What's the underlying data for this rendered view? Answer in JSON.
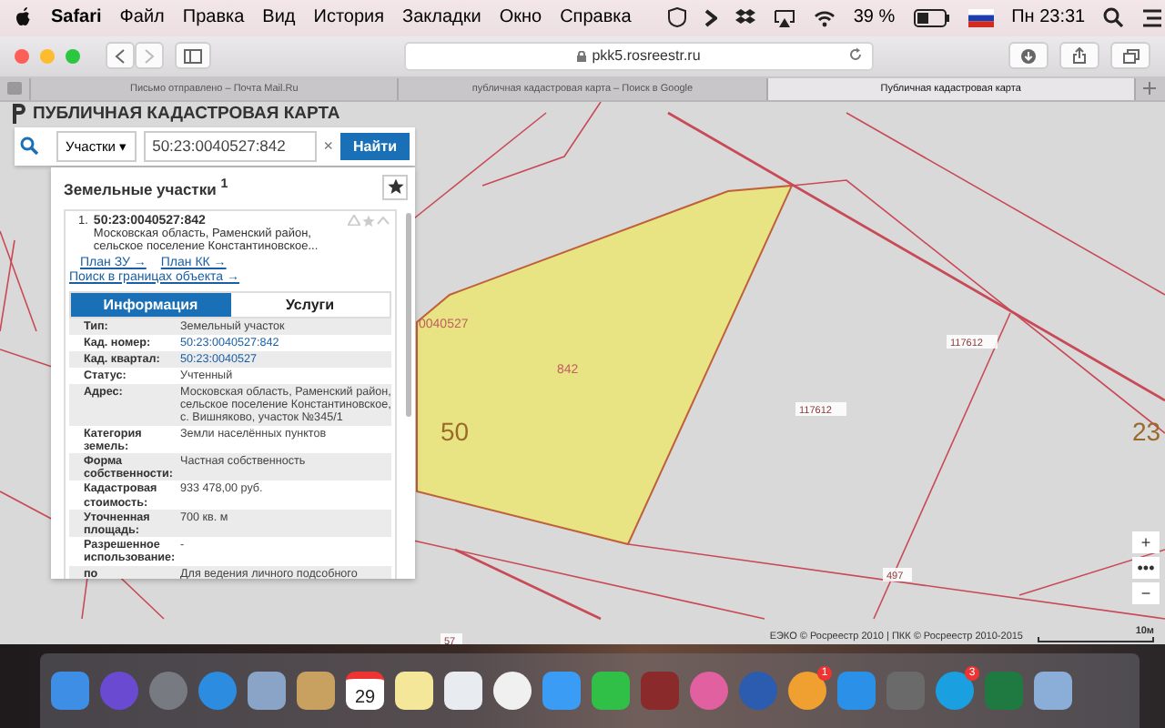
{
  "menu_bar": {
    "app": "Safari",
    "items": [
      "Файл",
      "Правка",
      "Вид",
      "История",
      "Закладки",
      "Окно",
      "Справка"
    ],
    "battery": "39 %",
    "clock": "Пн 23:31"
  },
  "toolbar": {
    "url": "pkk5.rosreestr.ru"
  },
  "tabs": [
    {
      "label": "Письмо отправлено – Почта Mail.Ru",
      "selected": false
    },
    {
      "label": "публичная кадастровая карта – Поиск в Google",
      "selected": false
    },
    {
      "label": "Публичная кадастровая карта",
      "selected": true
    }
  ],
  "page": {
    "title": "ПУБЛИЧНАЯ КАДАСТРОВАЯ КАРТА",
    "search": {
      "category": "Участки ▾",
      "value": "50:23:0040527:842",
      "clear": "×",
      "button": "Найти"
    },
    "results": {
      "title": "Земельные участки $^{1}$",
      "item": {
        "index": "1.",
        "number": "50:23:0040527:842",
        "address": "Московская область, Раменский район, сельское поселение Константиновское...",
        "links": [
          "План ЗУ →",
          "План КК →",
          "Поиск в границах объекта →"
        ],
        "tabs": [
          {
            "label": "Информация",
            "selected": true
          },
          {
            "label": "Услуги",
            "selected": false
          }
        ],
        "rows": [
          {
            "label": "Тип:",
            "value": "Земельный участок",
            "kind": "text"
          },
          {
            "label": "Кад. номер:",
            "value": "50:23:0040527:842",
            "kind": "link"
          },
          {
            "label": "Кад. квартал:",
            "value": "50:23:0040527",
            "kind": "link"
          },
          {
            "label": "Статус:",
            "value": "Учтенный",
            "kind": "text"
          },
          {
            "label": "Адрес:",
            "value": "Московская область, Раменский район, сельское поселение Константиновское, с. Вишняково, участок №345/1",
            "kind": "text"
          },
          {
            "label": "Категория земель:",
            "value": "Земли населённых пунктов",
            "kind": "text"
          },
          {
            "label": "Форма собственности:",
            "value": "Частная собственность",
            "kind": "text"
          },
          {
            "label": "Кадастровая стоимость:",
            "value": "933 478,00 руб.",
            "kind": "text"
          },
          {
            "label": "Уточненная площадь:",
            "value": "700 кв. м",
            "kind": "text"
          },
          {
            "label": "Разрешенное использование:",
            "value": "-",
            "kind": "text"
          },
          {
            "label": "по",
            "value": "Для ведения личного подсобного",
            "kind": "text"
          }
        ]
      }
    },
    "map": {
      "labels": [
        {
          "text": "50",
          "kind": "big"
        },
        {
          "text": "23",
          "kind": "big"
        },
        {
          "text": "0040527",
          "kind": "small"
        },
        {
          "text": "842",
          "kind": "small"
        },
        {
          "text": "117612",
          "kind": "boxed"
        },
        {
          "text": "117612",
          "kind": "boxed"
        },
        {
          "text": "497",
          "kind": "boxed"
        },
        {
          "text": "57",
          "kind": "boxed"
        }
      ],
      "zoom": [
        "+",
        "•••",
        "−"
      ],
      "attribution": "ЕЭКО © Росреестр 2010 | ПКК © Росреестр 2010-2015",
      "scale": "10м"
    }
  },
  "dock": {
    "calendar_day": "29",
    "badges": {
      "app_store": "1",
      "skype": "3"
    }
  }
}
